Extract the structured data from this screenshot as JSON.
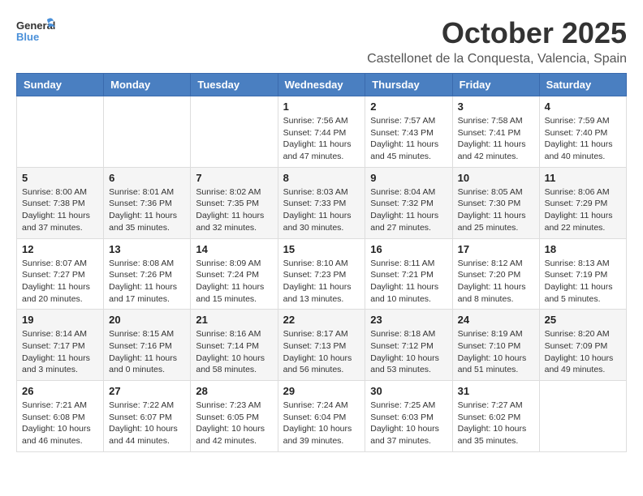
{
  "logo": {
    "general": "General",
    "blue": "Blue"
  },
  "title": "October 2025",
  "location": "Castellonet de la Conquesta, Valencia, Spain",
  "weekdays": [
    "Sunday",
    "Monday",
    "Tuesday",
    "Wednesday",
    "Thursday",
    "Friday",
    "Saturday"
  ],
  "weeks": [
    [
      {
        "day": "",
        "sunrise": "",
        "sunset": "",
        "daylight": ""
      },
      {
        "day": "",
        "sunrise": "",
        "sunset": "",
        "daylight": ""
      },
      {
        "day": "",
        "sunrise": "",
        "sunset": "",
        "daylight": ""
      },
      {
        "day": "1",
        "sunrise": "Sunrise: 7:56 AM",
        "sunset": "Sunset: 7:44 PM",
        "daylight": "Daylight: 11 hours and 47 minutes."
      },
      {
        "day": "2",
        "sunrise": "Sunrise: 7:57 AM",
        "sunset": "Sunset: 7:43 PM",
        "daylight": "Daylight: 11 hours and 45 minutes."
      },
      {
        "day": "3",
        "sunrise": "Sunrise: 7:58 AM",
        "sunset": "Sunset: 7:41 PM",
        "daylight": "Daylight: 11 hours and 42 minutes."
      },
      {
        "day": "4",
        "sunrise": "Sunrise: 7:59 AM",
        "sunset": "Sunset: 7:40 PM",
        "daylight": "Daylight: 11 hours and 40 minutes."
      }
    ],
    [
      {
        "day": "5",
        "sunrise": "Sunrise: 8:00 AM",
        "sunset": "Sunset: 7:38 PM",
        "daylight": "Daylight: 11 hours and 37 minutes."
      },
      {
        "day": "6",
        "sunrise": "Sunrise: 8:01 AM",
        "sunset": "Sunset: 7:36 PM",
        "daylight": "Daylight: 11 hours and 35 minutes."
      },
      {
        "day": "7",
        "sunrise": "Sunrise: 8:02 AM",
        "sunset": "Sunset: 7:35 PM",
        "daylight": "Daylight: 11 hours and 32 minutes."
      },
      {
        "day": "8",
        "sunrise": "Sunrise: 8:03 AM",
        "sunset": "Sunset: 7:33 PM",
        "daylight": "Daylight: 11 hours and 30 minutes."
      },
      {
        "day": "9",
        "sunrise": "Sunrise: 8:04 AM",
        "sunset": "Sunset: 7:32 PM",
        "daylight": "Daylight: 11 hours and 27 minutes."
      },
      {
        "day": "10",
        "sunrise": "Sunrise: 8:05 AM",
        "sunset": "Sunset: 7:30 PM",
        "daylight": "Daylight: 11 hours and 25 minutes."
      },
      {
        "day": "11",
        "sunrise": "Sunrise: 8:06 AM",
        "sunset": "Sunset: 7:29 PM",
        "daylight": "Daylight: 11 hours and 22 minutes."
      }
    ],
    [
      {
        "day": "12",
        "sunrise": "Sunrise: 8:07 AM",
        "sunset": "Sunset: 7:27 PM",
        "daylight": "Daylight: 11 hours and 20 minutes."
      },
      {
        "day": "13",
        "sunrise": "Sunrise: 8:08 AM",
        "sunset": "Sunset: 7:26 PM",
        "daylight": "Daylight: 11 hours and 17 minutes."
      },
      {
        "day": "14",
        "sunrise": "Sunrise: 8:09 AM",
        "sunset": "Sunset: 7:24 PM",
        "daylight": "Daylight: 11 hours and 15 minutes."
      },
      {
        "day": "15",
        "sunrise": "Sunrise: 8:10 AM",
        "sunset": "Sunset: 7:23 PM",
        "daylight": "Daylight: 11 hours and 13 minutes."
      },
      {
        "day": "16",
        "sunrise": "Sunrise: 8:11 AM",
        "sunset": "Sunset: 7:21 PM",
        "daylight": "Daylight: 11 hours and 10 minutes."
      },
      {
        "day": "17",
        "sunrise": "Sunrise: 8:12 AM",
        "sunset": "Sunset: 7:20 PM",
        "daylight": "Daylight: 11 hours and 8 minutes."
      },
      {
        "day": "18",
        "sunrise": "Sunrise: 8:13 AM",
        "sunset": "Sunset: 7:19 PM",
        "daylight": "Daylight: 11 hours and 5 minutes."
      }
    ],
    [
      {
        "day": "19",
        "sunrise": "Sunrise: 8:14 AM",
        "sunset": "Sunset: 7:17 PM",
        "daylight": "Daylight: 11 hours and 3 minutes."
      },
      {
        "day": "20",
        "sunrise": "Sunrise: 8:15 AM",
        "sunset": "Sunset: 7:16 PM",
        "daylight": "Daylight: 11 hours and 0 minutes."
      },
      {
        "day": "21",
        "sunrise": "Sunrise: 8:16 AM",
        "sunset": "Sunset: 7:14 PM",
        "daylight": "Daylight: 10 hours and 58 minutes."
      },
      {
        "day": "22",
        "sunrise": "Sunrise: 8:17 AM",
        "sunset": "Sunset: 7:13 PM",
        "daylight": "Daylight: 10 hours and 56 minutes."
      },
      {
        "day": "23",
        "sunrise": "Sunrise: 8:18 AM",
        "sunset": "Sunset: 7:12 PM",
        "daylight": "Daylight: 10 hours and 53 minutes."
      },
      {
        "day": "24",
        "sunrise": "Sunrise: 8:19 AM",
        "sunset": "Sunset: 7:10 PM",
        "daylight": "Daylight: 10 hours and 51 minutes."
      },
      {
        "day": "25",
        "sunrise": "Sunrise: 8:20 AM",
        "sunset": "Sunset: 7:09 PM",
        "daylight": "Daylight: 10 hours and 49 minutes."
      }
    ],
    [
      {
        "day": "26",
        "sunrise": "Sunrise: 7:21 AM",
        "sunset": "Sunset: 6:08 PM",
        "daylight": "Daylight: 10 hours and 46 minutes."
      },
      {
        "day": "27",
        "sunrise": "Sunrise: 7:22 AM",
        "sunset": "Sunset: 6:07 PM",
        "daylight": "Daylight: 10 hours and 44 minutes."
      },
      {
        "day": "28",
        "sunrise": "Sunrise: 7:23 AM",
        "sunset": "Sunset: 6:05 PM",
        "daylight": "Daylight: 10 hours and 42 minutes."
      },
      {
        "day": "29",
        "sunrise": "Sunrise: 7:24 AM",
        "sunset": "Sunset: 6:04 PM",
        "daylight": "Daylight: 10 hours and 39 minutes."
      },
      {
        "day": "30",
        "sunrise": "Sunrise: 7:25 AM",
        "sunset": "Sunset: 6:03 PM",
        "daylight": "Daylight: 10 hours and 37 minutes."
      },
      {
        "day": "31",
        "sunrise": "Sunrise: 7:27 AM",
        "sunset": "Sunset: 6:02 PM",
        "daylight": "Daylight: 10 hours and 35 minutes."
      },
      {
        "day": "",
        "sunrise": "",
        "sunset": "",
        "daylight": ""
      }
    ]
  ]
}
